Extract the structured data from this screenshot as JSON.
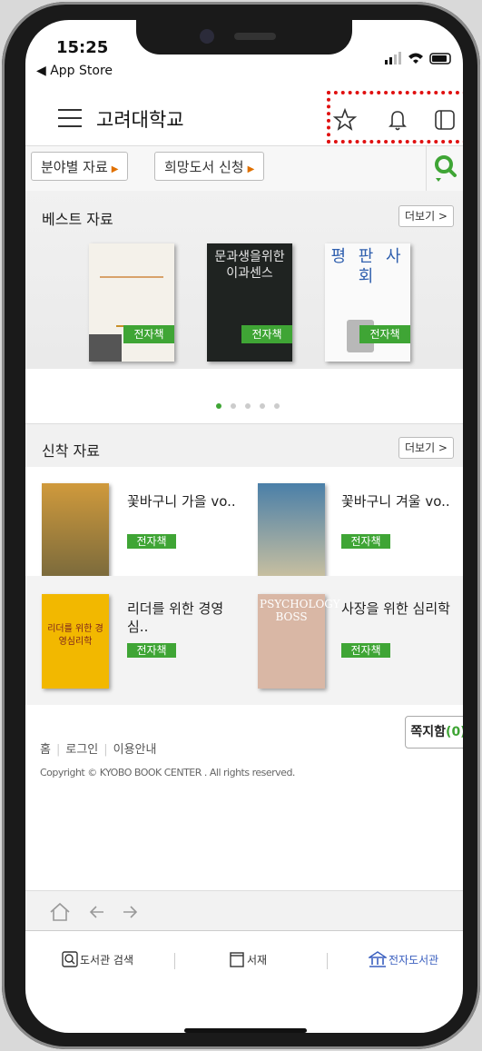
{
  "status": {
    "time": "15:25",
    "back_app": "◀ App Store"
  },
  "header": {
    "title": "고려대학교"
  },
  "subnav": {
    "field_label": "분야별 자료",
    "request_label": "희망도서 신청"
  },
  "best": {
    "title": "베스트 자료",
    "more": "더보기 >",
    "books": [
      {
        "badge": "전자책"
      },
      {
        "badge": "전자책",
        "cover_title": "문과생을위한 이과센스"
      },
      {
        "badge": "전자책",
        "cover_title": "평 판 사 회"
      }
    ],
    "pages": 5,
    "current_page": 1
  },
  "new": {
    "title": "신착 자료",
    "more": "더보기 >",
    "items": [
      {
        "title": "꽃바구니 가을 vo..",
        "badge": "전자책"
      },
      {
        "title": "꽃바구니 겨울 vo..",
        "badge": "전자책"
      },
      {
        "title": "리더를 위한 경영 심..",
        "badge": "전자책",
        "cover_title": "리더를 위한 경영심리학"
      },
      {
        "title": "사장을 위한 심리학",
        "badge": "전자책",
        "cover_title": "PSYCHOLOGY BOSS"
      }
    ]
  },
  "footer": {
    "home": "홈",
    "login": "로그인",
    "guide": "이용안내",
    "note_label": "쪽지함",
    "note_count": "(0)",
    "copyright": "Copyright © KYOBO BOOK CENTER . All rights reserved."
  },
  "tabs": {
    "search": "도서관 검색",
    "shelf": "서재",
    "ebook": "전자도서관"
  },
  "colors": {
    "accent": "#3fa535",
    "highlight": "#e01010",
    "active_tab": "#3a5fbf"
  }
}
